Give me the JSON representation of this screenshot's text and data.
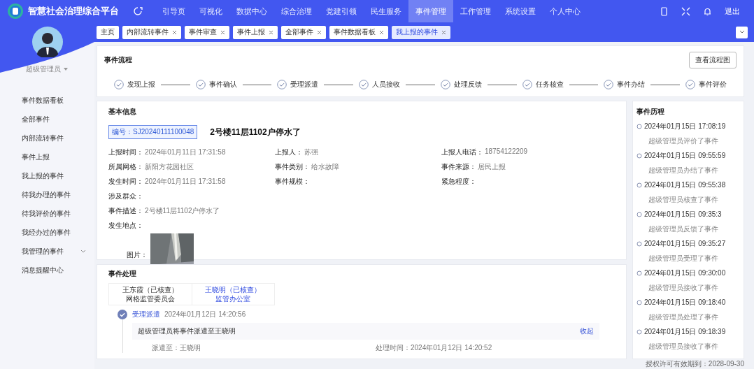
{
  "header": {
    "title": "智慧社会治理综合平台",
    "nav": [
      {
        "label": "引导页",
        "selected": false
      },
      {
        "label": "可视化",
        "selected": false
      },
      {
        "label": "数据中心",
        "selected": false
      },
      {
        "label": "综合治理",
        "selected": false
      },
      {
        "label": "党建引领",
        "selected": false
      },
      {
        "label": "民生服务",
        "selected": false
      },
      {
        "label": "事件管理",
        "selected": true
      },
      {
        "label": "工作管理",
        "selected": false
      },
      {
        "label": "系统设置",
        "selected": false
      },
      {
        "label": "个人中心",
        "selected": false
      }
    ],
    "logout": "退出"
  },
  "tabs": [
    {
      "label": "主页",
      "selected": false,
      "closable": false
    },
    {
      "label": "内部流转事件",
      "selected": false,
      "closable": true
    },
    {
      "label": "事件审查",
      "selected": false,
      "closable": true
    },
    {
      "label": "事件上报",
      "selected": false,
      "closable": true
    },
    {
      "label": "全部事件",
      "selected": false,
      "closable": true
    },
    {
      "label": "事件数据看板",
      "selected": false,
      "closable": true
    },
    {
      "label": "我上报的事件",
      "selected": true,
      "closable": true
    }
  ],
  "sidebar": {
    "user": "超级管理员",
    "items": [
      {
        "label": "事件数据看板",
        "kind": "item"
      },
      {
        "label": "全部事件",
        "kind": "item"
      },
      {
        "label": "内部流转事件",
        "kind": "item"
      },
      {
        "label": "事件上报",
        "kind": "item"
      },
      {
        "label": "我上报的事件",
        "kind": "item"
      },
      {
        "label": "待我办理的事件",
        "kind": "item"
      },
      {
        "label": "待我评价的事件",
        "kind": "item"
      },
      {
        "label": "我经办过的事件",
        "kind": "item"
      },
      {
        "label": "我管理的事件",
        "kind": "group"
      },
      {
        "label": "消息提醒中心",
        "kind": "item"
      }
    ]
  },
  "flow": {
    "title": "事件流程",
    "button": "查看流程图",
    "steps": [
      {
        "label": "发现上报",
        "done": true
      },
      {
        "label": "事件确认",
        "done": true
      },
      {
        "label": "受理派遣",
        "done": true
      },
      {
        "label": "人员接收",
        "done": true
      },
      {
        "label": "处理反馈",
        "done": true
      },
      {
        "label": "任务核查",
        "done": true
      },
      {
        "label": "事件办结",
        "done": true
      },
      {
        "label": "事件评价",
        "done": true
      }
    ]
  },
  "basic_info": {
    "title": "基本信息",
    "number_label": "编号：",
    "number": "SJ20240111100048",
    "event_title": "2号楼11层1102户停水了",
    "fields": [
      {
        "label": "上报时间：",
        "value": "2024年01月11日 17:31:58"
      },
      {
        "label": "上报人：",
        "value": "苏强"
      },
      {
        "label": "上报人电话：",
        "value": "18754122209"
      },
      {
        "label": "所属网格：",
        "value": "新阳方花园社区"
      },
      {
        "label": "事件类别：",
        "value": "给水故障"
      },
      {
        "label": "事件来源：",
        "value": "居民上报"
      },
      {
        "label": "发生时间：",
        "value": "2024年01月11日 17:31:58"
      },
      {
        "label": "事件规模："
      },
      {
        "label": "紧急程度："
      }
    ],
    "wide_fields": [
      {
        "label": "涉及群众："
      },
      {
        "label": "事件描述：",
        "value": "2号楼11层1102户停水了"
      },
      {
        "label": "发生地点："
      }
    ],
    "image_label": "图片："
  },
  "processing": {
    "title": "事件处理",
    "handlers": [
      {
        "name": "王东霞（已核查）",
        "unit": "网格监管委员会",
        "selected": false
      },
      {
        "name": "王晓明（已核查）",
        "unit": "监管办公室",
        "selected": true
      }
    ],
    "records": [
      {
        "step": "受理派遣",
        "time": "2024年01月12日 14:20:56",
        "message": "超级管理员将事件派遣至王晓明",
        "toggle": "收起",
        "assignee": "派遣至：王晓明",
        "handled": "处理时间：2024年01月12日 14:20:52"
      }
    ]
  },
  "history": {
    "title": "事件历程",
    "entries": [
      {
        "time": "2024年01月15日 17:08:19",
        "text": "超级管理员评价了事件"
      },
      {
        "time": "2024年01月15日 09:55:59",
        "text": "超级管理员办结了事件"
      },
      {
        "time": "2024年01月15日 09:55:38",
        "text": "超级管理员核查了事件"
      },
      {
        "time": "2024年01月15日 09:35:3",
        "text": "超级管理员反馈了事件"
      },
      {
        "time": "2024年01月15日 09:35:27",
        "text": "超级管理员受理了事件"
      },
      {
        "time": "2024年01月15日 09:30:00",
        "text": "超级管理员接收了事件"
      },
      {
        "time": "2024年01月15日 09:18:40",
        "text": "超级管理员处理了事件"
      },
      {
        "time": "2024年01月15日 09:18:39",
        "text": "超级管理员接收了事件"
      }
    ]
  },
  "footer": "授权许可有效期到：2028-09-30"
}
